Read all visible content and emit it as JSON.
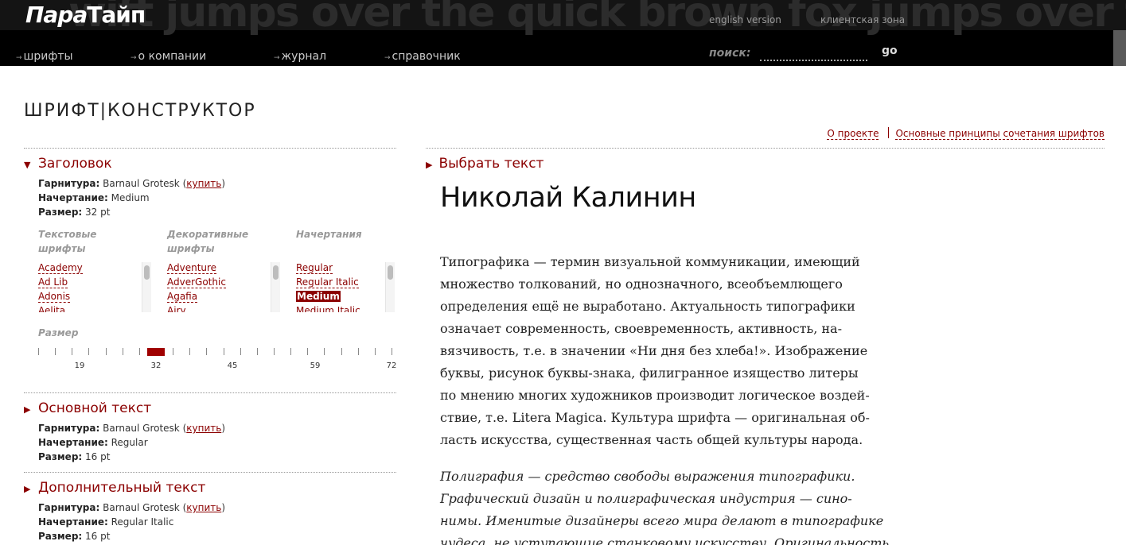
{
  "header": {
    "logo_part1": "Пара",
    "logo_part2": "Тайп",
    "bg_text": "wift jumps over the quick brown fox jumps over the quick brown f",
    "english_version": "english version",
    "client_zone": "клиентская зона",
    "nav": [
      {
        "label": "шрифты"
      },
      {
        "label": "о компании"
      },
      {
        "label": "журнал"
      },
      {
        "label": "справочник"
      }
    ],
    "search_label": "поиск:",
    "search_value": "",
    "go_label": "go"
  },
  "page": {
    "title": "ШРИФТ|КОНСТРУКТОР",
    "link_about": "О проекте",
    "link_principles": "Основные принципы сочетания шрифтов"
  },
  "sections": {
    "heading": {
      "title": "Заголовок",
      "family_label": "Гарнитура:",
      "family": "Barnaul Grotesk",
      "buy": "купить",
      "style_label": "Начертание:",
      "style": "Medium",
      "size_label": "Размер:",
      "size": "32 pt"
    },
    "body": {
      "title": "Основной текст",
      "family_label": "Гарнитура:",
      "family": "Barnaul Grotesk",
      "buy": "купить",
      "style_label": "Начертание:",
      "style": "Regular",
      "size_label": "Размер:",
      "size": "16 pt"
    },
    "extra": {
      "title": "Дополнительный текст",
      "family_label": "Гарнитура:",
      "family": "Barnaul Grotesk",
      "buy": "купить",
      "style_label": "Начертание:",
      "style": "Regular Italic",
      "size_label": "Размер:",
      "size": "16 pt"
    }
  },
  "lists": {
    "text_fonts_head": [
      "Текстовые",
      "шрифты"
    ],
    "decor_fonts_head": [
      "Декоративные",
      "шрифты"
    ],
    "styles_head": [
      "Начертания"
    ],
    "text_fonts": [
      "Academy",
      "Ad Lib",
      "Adonis",
      "Aelita"
    ],
    "decor_fonts": [
      "Adventure",
      "AdverGothic",
      "Agafia",
      "Airy"
    ],
    "styles": [
      "Regular",
      "Regular Italic",
      "Medium",
      "Medium Italic"
    ],
    "selected_style": "Medium"
  },
  "size_slider": {
    "label": "Размер",
    "tick_labels": [
      "19",
      "32",
      "45",
      "59",
      "72"
    ],
    "min": 12,
    "max": 72,
    "value": 32
  },
  "preview": {
    "choose_text": "Выбрать текст",
    "heading": "Николай Калинин",
    "para1": [
      "Типографика — термин визуальной коммуникации, имеющий",
      "множество толкований, но однозначного, всеобъемлющего",
      "определения ещё не выработано. Актуальность типографики",
      "означает современность, своевременность, активность, на-",
      "вязчивость, т.е. в значении «Ни дня без хлеба!». Изображение",
      "буквы, рисунок буквы-знака, филигранное изящество литеры",
      "по мнению многих художников производит логическое воздей-",
      "ствие, т.е. Litera Magica. Культура шрифта — оригинальная об-",
      "ласть искусства, существенная часть общей культуры народа."
    ],
    "para2": [
      "Полиграфия — средство свободы выражения типографики.",
      "Графический дизайн и полиграфическая индустрия — сино-",
      "нимы. Именитые дизайнеры всего мира делают в типографике",
      "чудеса, не уступающие станковому искусству. Оригинальность"
    ]
  },
  "colors": {
    "accent": "#8b0000",
    "slider_handle": "#a00000",
    "header_bg": "#000000"
  }
}
